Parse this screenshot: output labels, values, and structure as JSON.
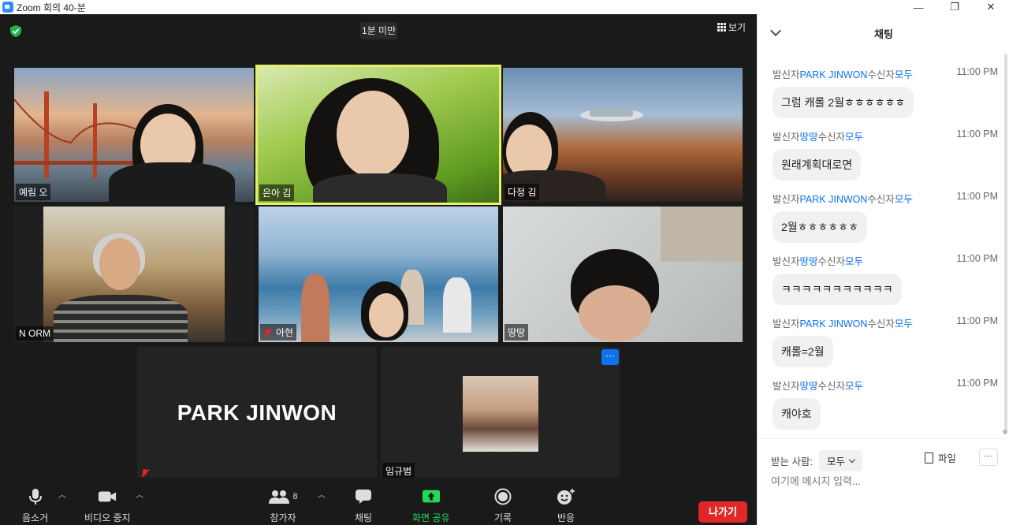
{
  "window": {
    "title": "Zoom 회의 40-분",
    "minimize": "—",
    "restore": "❐",
    "close": "✕"
  },
  "meeting": {
    "duration": "1분 미만",
    "view_label": "보기"
  },
  "participants": [
    {
      "name": "예림 오"
    },
    {
      "name": "은아 김"
    },
    {
      "name": "다정 김"
    },
    {
      "name": "N ORM"
    },
    {
      "name": "아현"
    },
    {
      "name": "땅땅"
    },
    {
      "name": "PARK JINWON"
    },
    {
      "name": "임규범"
    }
  ],
  "toolbar": {
    "mute": "음소거",
    "stop_video": "비디오 중지",
    "participants": "참가자",
    "participants_count": "8",
    "chat": "채팅",
    "share_screen": "화면 공유",
    "record": "기록",
    "reactions": "반응",
    "leave": "나가기"
  },
  "chat": {
    "title": "채팅",
    "from_label": "발신자",
    "to_label": "수신자",
    "everyone": "모두",
    "messages": [
      {
        "sender": "PARK JINWON",
        "time": "11:00 PM",
        "text": "그럼 캐롤 2월ㅎㅎㅎㅎㅎㅎ"
      },
      {
        "sender": "땅땅",
        "time": "11:00 PM",
        "text": "원래계획대로면"
      },
      {
        "sender": "PARK JINWON",
        "time": "11:00 PM",
        "text": "2월ㅎㅎㅎㅎㅎㅎ"
      },
      {
        "sender": "땅땅",
        "time": "11:00 PM",
        "text": "ㅋㅋㅋㅋㅋㅋㅋㅋㅋㅋㅋ"
      },
      {
        "sender": "PARK JINWON",
        "time": "11:00 PM",
        "text": "캐롤=2월"
      },
      {
        "sender": "땅땅",
        "time": "11:00 PM",
        "text": "캐야호"
      }
    ],
    "to_row_label": "받는 사람:",
    "to_select": "모두",
    "file_label": "파일",
    "more": "···",
    "input_placeholder": "여기에 메시지 입력..."
  },
  "colors": {
    "accent": "#0e71eb",
    "leave": "#e02828",
    "share": "#23d959",
    "active_speaker": "#e8f06b"
  }
}
